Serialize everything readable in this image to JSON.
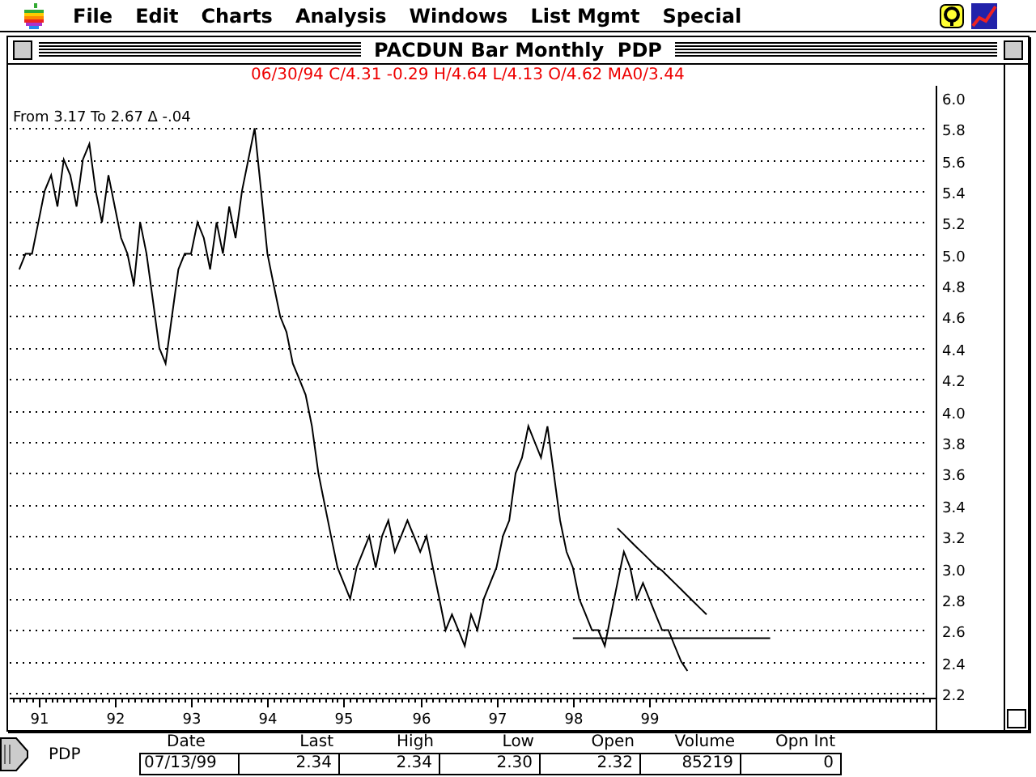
{
  "menu_bar": {
    "items": [
      "File",
      "Edit",
      "Charts",
      "Analysis",
      "Windows",
      "List Mgmt",
      "Special"
    ]
  },
  "window": {
    "title": "PACDUN Bar Monthly  PDP",
    "quote_line": "06/30/94 C/4.31 -0.29 H/4.64 L/4.13 O/4.62 MA0/3.44",
    "readout": "From 3.17 To 2.67 Δ -.04",
    "chart_data": {
      "type": "line",
      "grid": true,
      "xlim": [
        1990.625,
        2002.75
      ],
      "ylim": [
        2.17,
        6.07
      ],
      "xticks": [
        {
          "value": 1991,
          "label": "91"
        },
        {
          "value": 1992,
          "label": "92"
        },
        {
          "value": 1993,
          "label": "93"
        },
        {
          "value": 1994,
          "label": "94"
        },
        {
          "value": 1995,
          "label": "95"
        },
        {
          "value": 1996,
          "label": "96"
        },
        {
          "value": 1997,
          "label": "97"
        },
        {
          "value": 1998,
          "label": "98"
        },
        {
          "value": 1999,
          "label": "99"
        }
      ],
      "yticks": [
        {
          "value": 6.0,
          "label": "6.0"
        },
        {
          "value": 5.8,
          "label": "5.8"
        },
        {
          "value": 5.6,
          "label": "5.6"
        },
        {
          "value": 5.4,
          "label": "5.4"
        },
        {
          "value": 5.2,
          "label": "5.2"
        },
        {
          "value": 5.0,
          "label": "5.0"
        },
        {
          "value": 4.8,
          "label": "4.8"
        },
        {
          "value": 4.6,
          "label": "4.6"
        },
        {
          "value": 4.4,
          "label": "4.4"
        },
        {
          "value": 4.2,
          "label": "4.2"
        },
        {
          "value": 4.0,
          "label": "4.0"
        },
        {
          "value": 3.8,
          "label": "3.8"
        },
        {
          "value": 3.6,
          "label": "3.6"
        },
        {
          "value": 3.4,
          "label": "3.4"
        },
        {
          "value": 3.2,
          "label": "3.2"
        },
        {
          "value": 3.0,
          "label": "3.0"
        },
        {
          "value": 2.8,
          "label": "2.8"
        },
        {
          "value": 2.6,
          "label": "2.6"
        },
        {
          "value": 2.4,
          "label": "2.4"
        },
        {
          "value": 2.2,
          "label": "2.2"
        }
      ],
      "x": [
        1990.75,
        1990.833,
        1990.917,
        1991,
        1991.083,
        1991.167,
        1991.25,
        1991.333,
        1991.417,
        1991.5,
        1991.583,
        1991.667,
        1991.75,
        1991.833,
        1991.917,
        1992,
        1992.083,
        1992.167,
        1992.25,
        1992.333,
        1992.417,
        1992.5,
        1992.583,
        1992.667,
        1992.75,
        1992.833,
        1992.917,
        1993,
        1993.083,
        1993.167,
        1993.25,
        1993.333,
        1993.417,
        1993.5,
        1993.583,
        1993.667,
        1993.75,
        1993.833,
        1993.917,
        1994,
        1994.083,
        1994.167,
        1994.25,
        1994.333,
        1994.417,
        1994.5,
        1994.583,
        1994.667,
        1994.75,
        1994.833,
        1994.917,
        1995,
        1995.083,
        1995.167,
        1995.25,
        1995.333,
        1995.417,
        1995.5,
        1995.583,
        1995.667,
        1995.75,
        1995.833,
        1995.917,
        1996,
        1996.083,
        1996.167,
        1996.25,
        1996.333,
        1996.417,
        1996.5,
        1996.583,
        1996.667,
        1996.75,
        1996.833,
        1996.917,
        1997,
        1997.083,
        1997.167,
        1997.25,
        1997.333,
        1997.417,
        1997.5,
        1997.583,
        1997.667,
        1997.75,
        1997.833,
        1997.917,
        1998,
        1998.083,
        1998.167,
        1998.25,
        1998.333,
        1998.417,
        1998.5,
        1998.583,
        1998.667,
        1998.75,
        1998.833,
        1998.917,
        1999,
        1999.083,
        1999.167,
        1999.25,
        1999.333,
        1999.417,
        1999.5,
        1999.583,
        1999.667,
        1999.75,
        1999.833,
        1999.917,
        2000,
        2000.083,
        2000.167,
        2000.25,
        2000.333,
        2000.417,
        2000.5,
        2000.583
      ],
      "series": [
        {
          "color": "#000000",
          "values": [
            4.9,
            5.0,
            5.0,
            5.2,
            5.4,
            5.5,
            5.3,
            5.6,
            5.5,
            5.3,
            5.6,
            5.7,
            5.4,
            5.2,
            5.5,
            5.3,
            5.1,
            5.0,
            4.8,
            5.2,
            5.0,
            4.7,
            4.4,
            4.3,
            4.6,
            4.9,
            5.0,
            5.0,
            5.2,
            5.1,
            4.9,
            5.2,
            5.0,
            5.3,
            5.1,
            5.4,
            5.6,
            5.8,
            5.4,
            5.0,
            4.8,
            4.6,
            4.5,
            4.3,
            4.2,
            4.1,
            3.9,
            3.6,
            3.4,
            3.2,
            3.0,
            2.9,
            2.8,
            3.0,
            3.1,
            3.2,
            3.0,
            3.2,
            3.3,
            3.1,
            3.2,
            3.3,
            3.2,
            3.1,
            3.2,
            3.0,
            2.8,
            2.6,
            2.7,
            2.6,
            2.5,
            2.7,
            2.6,
            2.8,
            2.9,
            3.0,
            3.2,
            3.3,
            3.6,
            3.7,
            3.9,
            3.8,
            3.7,
            3.9,
            3.6,
            3.3,
            3.1,
            3.0,
            2.8,
            2.7,
            2.6,
            2.6,
            2.5,
            2.7,
            2.9,
            3.1,
            3.0,
            2.8,
            2.9,
            2.8,
            2.7,
            2.6,
            2.6,
            2.5,
            2.4,
            2.34,
            null,
            null,
            null,
            null,
            null,
            null,
            null,
            null,
            null,
            null,
            null,
            null,
            null
          ]
        },
        {
          "color": "#000000",
          "values": [
            null,
            null,
            null,
            null,
            null,
            null,
            null,
            null,
            null,
            null,
            null,
            null,
            null,
            null,
            null,
            null,
            null,
            null,
            null,
            null,
            null,
            null,
            null,
            null,
            null,
            null,
            null,
            null,
            null,
            null,
            null,
            null,
            null,
            null,
            null,
            null,
            null,
            null,
            null,
            null,
            null,
            null,
            null,
            null,
            null,
            null,
            null,
            null,
            null,
            null,
            null,
            null,
            null,
            null,
            null,
            null,
            null,
            null,
            null,
            null,
            null,
            null,
            null,
            null,
            null,
            null,
            null,
            null,
            null,
            null,
            null,
            null,
            null,
            null,
            null,
            null,
            null,
            null,
            null,
            null,
            null,
            null,
            null,
            null,
            null,
            null,
            null,
            2.55,
            2.55,
            2.55,
            2.55,
            2.55,
            2.55,
            2.55,
            2.55,
            2.55,
            2.55,
            2.55,
            2.55,
            2.55,
            2.55,
            2.55,
            2.55,
            2.55,
            2.55,
            2.55,
            2.55,
            2.55,
            2.55,
            2.55,
            2.55,
            2.55,
            2.55,
            2.55,
            2.55,
            2.55,
            2.55,
            2.55,
            2.55
          ]
        },
        {
          "color": "#000000",
          "values": [
            null,
            null,
            null,
            null,
            null,
            null,
            null,
            null,
            null,
            null,
            null,
            null,
            null,
            null,
            null,
            null,
            null,
            null,
            null,
            null,
            null,
            null,
            null,
            null,
            null,
            null,
            null,
            null,
            null,
            null,
            null,
            null,
            null,
            null,
            null,
            null,
            null,
            null,
            null,
            null,
            null,
            null,
            null,
            null,
            null,
            null,
            null,
            null,
            null,
            null,
            null,
            null,
            null,
            null,
            null,
            null,
            null,
            null,
            null,
            null,
            null,
            null,
            null,
            null,
            null,
            null,
            null,
            null,
            null,
            null,
            null,
            null,
            null,
            null,
            null,
            null,
            null,
            null,
            null,
            null,
            null,
            null,
            null,
            null,
            null,
            null,
            null,
            null,
            null,
            null,
            null,
            null,
            null,
            null,
            3.25,
            3.21,
            3.17,
            3.13,
            3.09,
            3.05,
            3.01,
            2.98,
            2.94,
            2.9,
            2.86,
            2.82,
            2.78,
            2.74,
            2.7,
            null,
            null,
            null,
            null,
            null,
            null,
            null,
            null,
            null,
            null
          ]
        }
      ]
    }
  },
  "quote_bar": {
    "symbol": "PDP",
    "columns": [
      {
        "label": "Date",
        "value": "07/13/99"
      },
      {
        "label": "Last",
        "value": "2.34"
      },
      {
        "label": "High",
        "value": "2.34"
      },
      {
        "label": "Low",
        "value": "2.30"
      },
      {
        "label": "Open",
        "value": "2.32"
      },
      {
        "label": "Volume",
        "value": "85219"
      },
      {
        "label": "Opn Int",
        "value": "0"
      }
    ]
  }
}
